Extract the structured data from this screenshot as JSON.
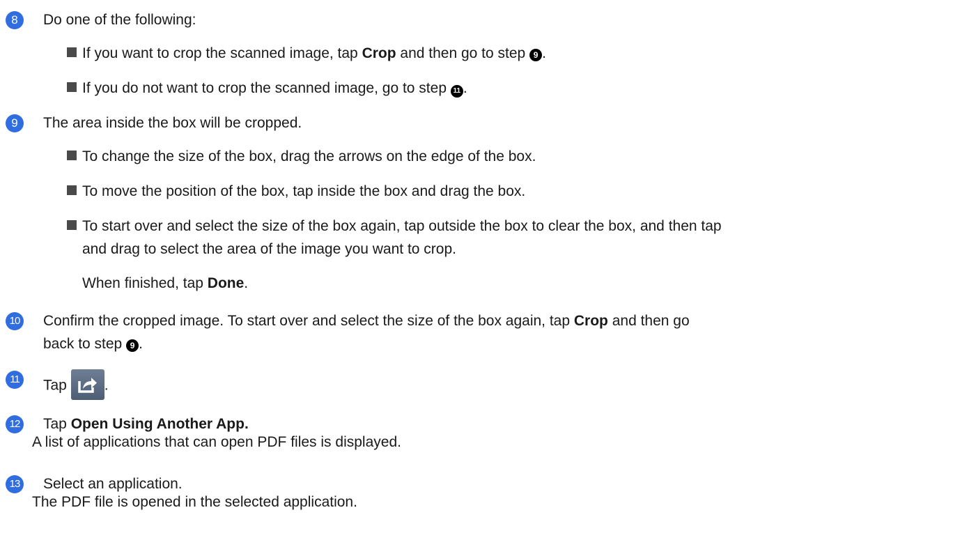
{
  "steps": [
    {
      "number": "8",
      "text": "Do one of the following:",
      "bullets": [
        {
          "pre": "If you want to crop the scanned image, tap ",
          "bold": "Crop",
          "mid": " and then go to step ",
          "ref": "9",
          "post": "."
        },
        {
          "pre": "If you do not want to crop the scanned image, go to step ",
          "ref": "11",
          "post": "."
        }
      ]
    },
    {
      "number": "9",
      "text": "The area inside the box will be cropped.",
      "bullets": [
        {
          "text": "To change the size of the box, drag the arrows on the edge of the box."
        },
        {
          "text": "To move the position of the box, tap inside the box and drag the box."
        },
        {
          "text_line1": "To start over and select the size of the box again, tap outside the box to clear the box, and then tap",
          "text_line2": "and drag to select the area of the image you want to crop."
        }
      ],
      "finish_pre": "When finished, tap ",
      "finish_bold": "Done",
      "finish_post": "."
    },
    {
      "number": "10",
      "line1_pre": "Confirm the cropped image. To start over and select the size of the box again, tap ",
      "line1_bold": "Crop",
      "line1_post": " and then go",
      "line2_pre": "back to step ",
      "line2_ref": "9",
      "line2_post": "."
    },
    {
      "number": "11",
      "text": "Tap",
      "post": ".",
      "icon": "share-icon"
    },
    {
      "number": "12",
      "pre": "Tap ",
      "bold": "Open Using Another App.",
      "line2": "A list of applications that can open PDF files is displayed."
    },
    {
      "number": "13",
      "text": "Select an application.",
      "line2": "The PDF file is opened in the selected application."
    }
  ],
  "colors": {
    "badge": "#2f6de0",
    "bullet": "#4a4a4a",
    "ref": "#000000",
    "icon_bg": "#5a6b80"
  }
}
